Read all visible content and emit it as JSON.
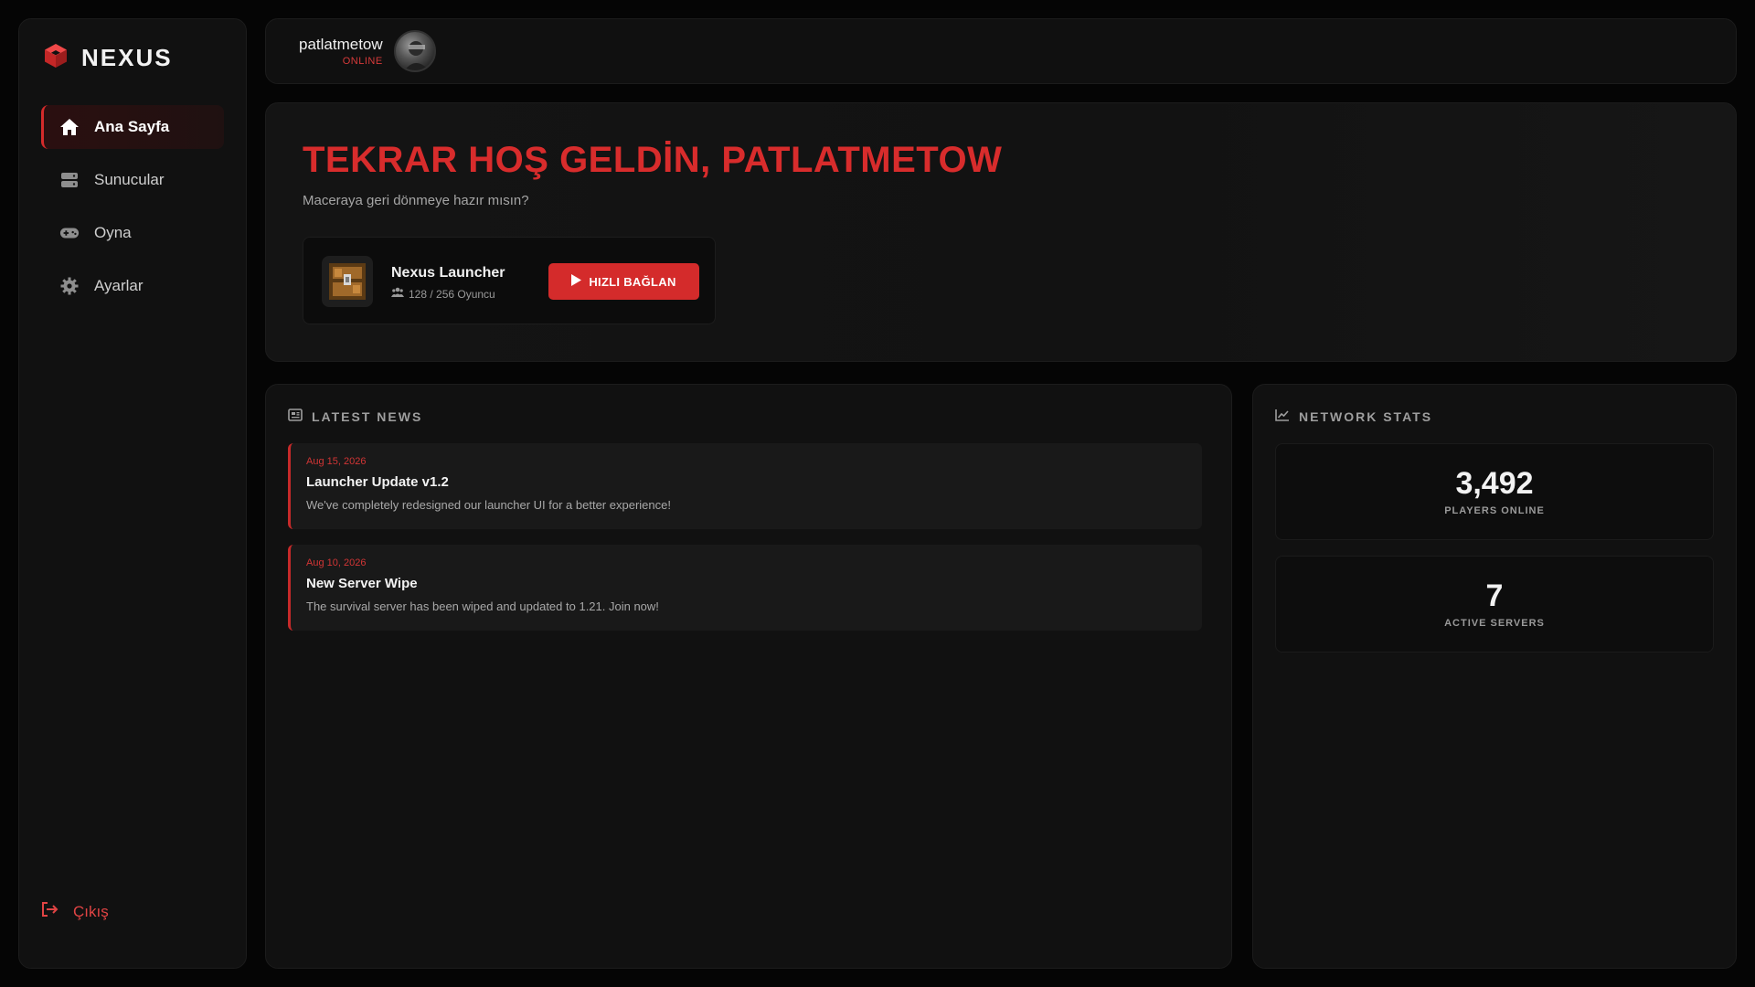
{
  "brand": {
    "name": "NEXUS",
    "accent": "#d42b2b"
  },
  "sidebar": {
    "items": [
      {
        "label": "Ana Sayfa",
        "icon": "home-icon",
        "active": true
      },
      {
        "label": "Sunucular",
        "icon": "server-icon",
        "active": false
      },
      {
        "label": "Oyna",
        "icon": "gamepad-icon",
        "active": false
      },
      {
        "label": "Ayarlar",
        "icon": "gear-icon",
        "active": false
      }
    ],
    "logout_label": "Çıkış"
  },
  "user": {
    "name": "patlatmetow",
    "status": "ONLINE"
  },
  "hero": {
    "title": "TEKRAR HOŞ GELDİN, PATLATMETOW",
    "subtitle": "Maceraya geri dönmeye hazır mısın?",
    "server": {
      "name": "Nexus Launcher",
      "players": "128 / 256 Oyuncu",
      "connect_label": "HIZLI BAĞLAN"
    }
  },
  "news": {
    "heading": "LATEST NEWS",
    "items": [
      {
        "date": "Aug 15, 2026",
        "title": "Launcher Update v1.2",
        "desc": "We've completely redesigned our launcher UI for a better experience!"
      },
      {
        "date": "Aug 10, 2026",
        "title": "New Server Wipe",
        "desc": "The survival server has been wiped and updated to 1.21. Join now!"
      }
    ]
  },
  "stats": {
    "heading": "NETWORK STATS",
    "items": [
      {
        "value": "3,492",
        "label": "PLAYERS ONLINE"
      },
      {
        "value": "7",
        "label": "ACTIVE SERVERS"
      }
    ]
  }
}
